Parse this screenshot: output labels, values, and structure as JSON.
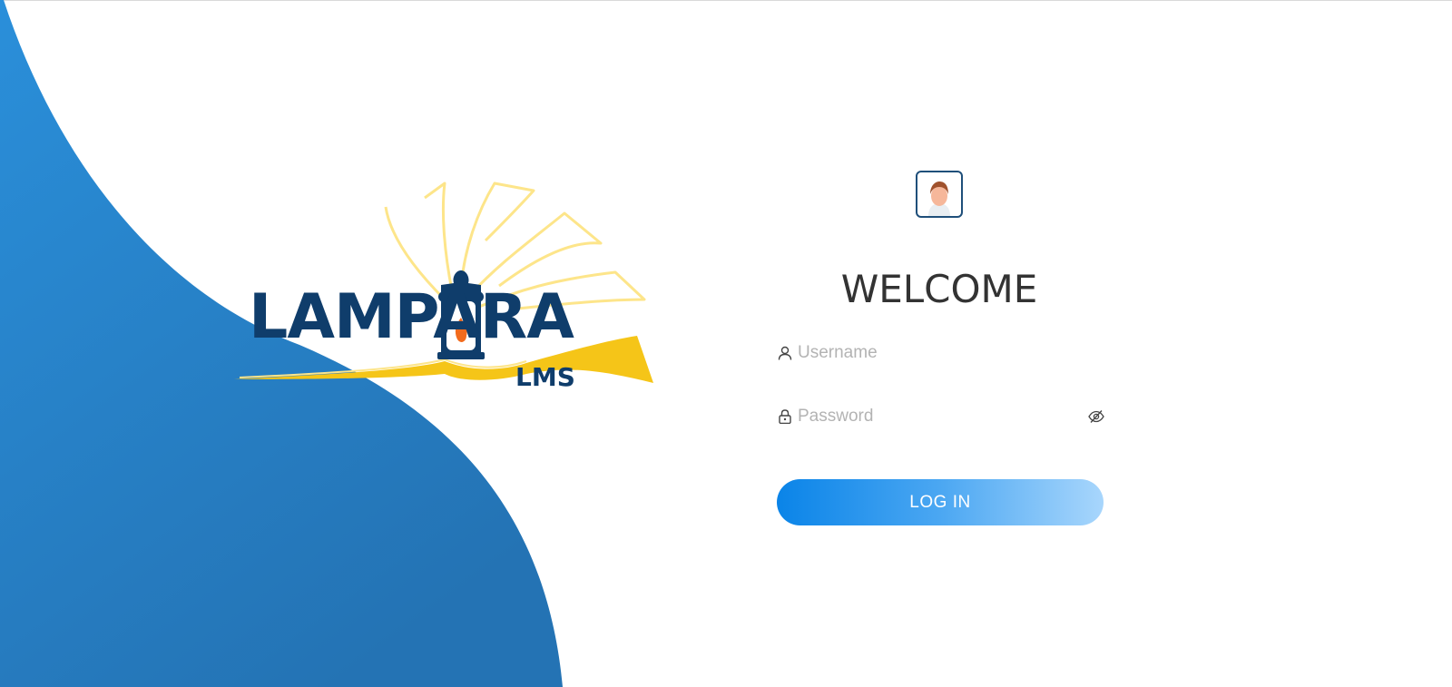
{
  "brand": {
    "logo_text": "LAMPARA",
    "logo_subtext": "LMS",
    "primary_color": "#2a7fc9",
    "accent_color": "#f5c518"
  },
  "login": {
    "welcome_title": "WELCOME",
    "username_placeholder": "Username",
    "password_placeholder": "Password",
    "login_label": "LOG IN",
    "button_gradient": [
      "#0a84e8",
      "#a8d6fc"
    ]
  },
  "icons": {
    "avatar": "user-avatar-icon",
    "username": "user-icon",
    "password": "lock-icon",
    "toggle_password": "eye-off-icon"
  }
}
